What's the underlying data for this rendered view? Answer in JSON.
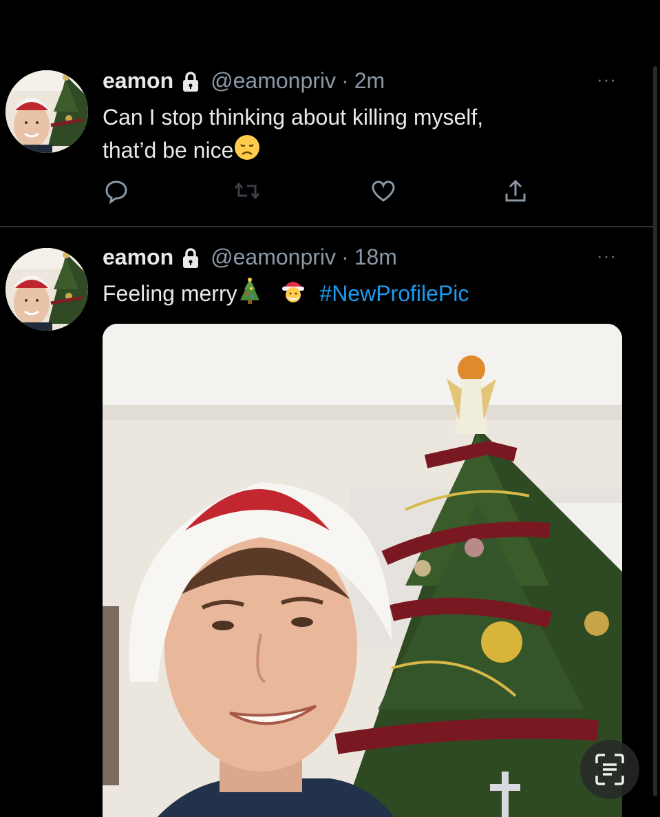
{
  "tweets": [
    {
      "display_name": "eamon",
      "handle": "@eamonpriv",
      "separator": "·",
      "time": "2m",
      "text_line1": "Can I stop thinking about killing myself,",
      "text_line2": "that’d be nice",
      "text_emoji": "disappointed-face-emoji",
      "more": "···"
    },
    {
      "display_name": "eamon",
      "handle": "@eamonpriv",
      "separator": "·",
      "time": "18m",
      "text": "Feeling merry",
      "emojis": [
        "christmas-tree-emoji",
        "santa-emoji"
      ],
      "hashtag": "#NewProfilePic",
      "more": "···"
    }
  ],
  "colors": {
    "background": "#000000",
    "text": "#e7e9ea",
    "secondary": "#8b98a5",
    "link": "#1d9bf0",
    "divider": "#2f3336"
  }
}
